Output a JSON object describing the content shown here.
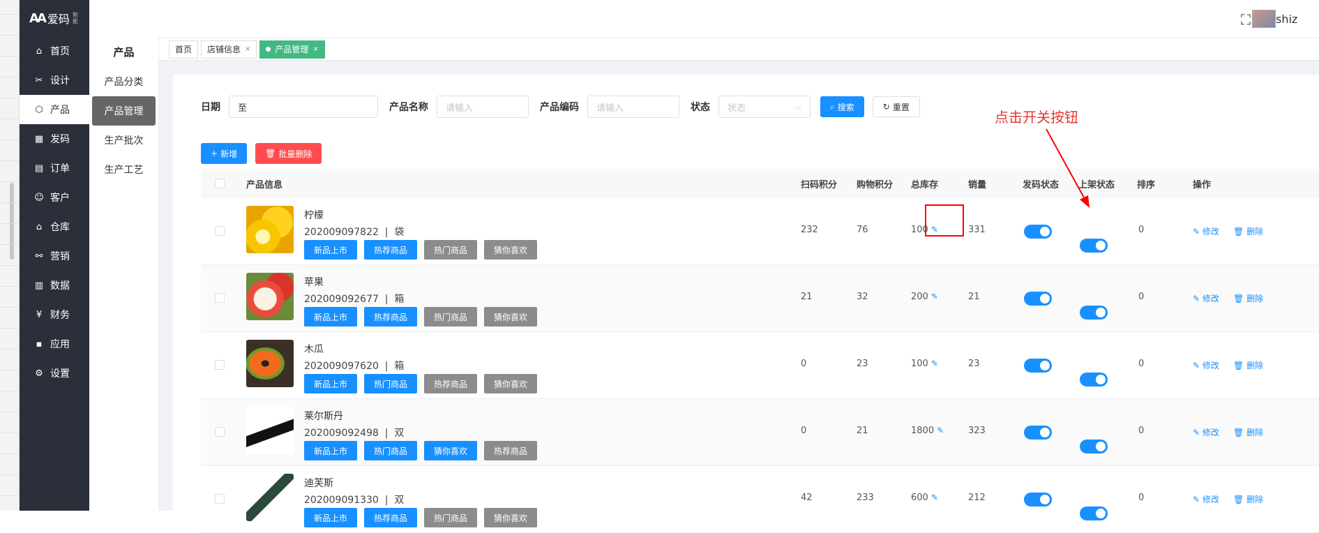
{
  "app": {
    "logo_mark": "AA",
    "logo_text": "爱码",
    "logo_sub": "智能"
  },
  "sidebar": {
    "items": [
      {
        "label": "首页",
        "icon": "home-icon",
        "glyph": "⌂"
      },
      {
        "label": "设计",
        "icon": "tools-icon",
        "glyph": "✂"
      },
      {
        "label": "产品",
        "icon": "cube-icon",
        "glyph": "⬡"
      },
      {
        "label": "发码",
        "icon": "qrcode-icon",
        "glyph": "▦"
      },
      {
        "label": "订单",
        "icon": "order-icon",
        "glyph": "▤"
      },
      {
        "label": "客户",
        "icon": "customer-icon",
        "glyph": "☺"
      },
      {
        "label": "仓库",
        "icon": "warehouse-icon",
        "glyph": "⌂"
      },
      {
        "label": "营销",
        "icon": "share-icon",
        "glyph": "⚯"
      },
      {
        "label": "数据",
        "icon": "chart-icon",
        "glyph": "▥"
      },
      {
        "label": "财务",
        "icon": "yen-icon",
        "glyph": "¥"
      },
      {
        "label": "应用",
        "icon": "grid-icon",
        "glyph": "▪"
      },
      {
        "label": "设置",
        "icon": "gear-icon",
        "glyph": "⚙"
      }
    ]
  },
  "subnav": {
    "title": "产品",
    "items": [
      "产品分类",
      "产品管理",
      "生产批次",
      "生产工艺"
    ]
  },
  "topbar": {
    "username": "shiz"
  },
  "tabs": [
    {
      "label": "首页"
    },
    {
      "label": "店铺信息",
      "x": "×"
    },
    {
      "label": "产品管理",
      "x": "×"
    }
  ],
  "filter": {
    "date_label": "日期",
    "date_sep": "至",
    "name_label": "产品名称",
    "name_placeholder": "请输入",
    "code_label": "产品编码",
    "code_placeholder": "请输入",
    "status_label": "状态",
    "status_placeholder": "状态",
    "search_label": "搜索",
    "reset_label": "重置"
  },
  "actions": {
    "add_label": "新增",
    "batch_delete_label": "批量删除"
  },
  "table": {
    "headers": [
      "产品信息",
      "扫码积分",
      "购物积分",
      "总库存",
      "销量",
      "发码状态",
      "上架状态",
      "排序",
      "操作"
    ],
    "edit_label": "修改",
    "delete_label": "删除",
    "rows": [
      {
        "name": "柠檬",
        "code": "202009097822",
        "unit": "袋",
        "tags": [
          {
            "t": "新品上市",
            "c": "blue"
          },
          {
            "t": "热荐商品",
            "c": "blue"
          },
          {
            "t": "热门商品",
            "c": "gray"
          },
          {
            "t": "猜你喜欢",
            "c": "gray"
          }
        ],
        "scan": "232",
        "shop": "76",
        "stock": "100",
        "sales": "331",
        "sort": "0",
        "img": "lemon"
      },
      {
        "name": "苹果",
        "code": "202009092677",
        "unit": "箱",
        "tags": [
          {
            "t": "新品上市",
            "c": "blue"
          },
          {
            "t": "热荐商品",
            "c": "blue"
          },
          {
            "t": "热门商品",
            "c": "gray"
          },
          {
            "t": "猜你喜欢",
            "c": "gray"
          }
        ],
        "scan": "21",
        "shop": "32",
        "stock": "200",
        "sales": "21",
        "sort": "0",
        "img": "apple"
      },
      {
        "name": "木瓜",
        "code": "202009097620",
        "unit": "箱",
        "tags": [
          {
            "t": "新品上市",
            "c": "blue"
          },
          {
            "t": "热门商品",
            "c": "blue"
          },
          {
            "t": "热荐商品",
            "c": "gray"
          },
          {
            "t": "猜你喜欢",
            "c": "gray"
          }
        ],
        "scan": "0",
        "shop": "23",
        "stock": "100",
        "sales": "23",
        "sort": "0",
        "img": "papaya"
      },
      {
        "name": "莱尔斯丹",
        "code": "202009092498",
        "unit": "双",
        "tags": [
          {
            "t": "新品上市",
            "c": "blue"
          },
          {
            "t": "热门商品",
            "c": "blue"
          },
          {
            "t": "猜你喜欢",
            "c": "blue"
          },
          {
            "t": "热荐商品",
            "c": "gray"
          }
        ],
        "scan": "0",
        "shop": "21",
        "stock": "1800",
        "sales": "323",
        "sort": "0",
        "img": "shoe1"
      },
      {
        "name": "迪芙斯",
        "code": "202009091330",
        "unit": "双",
        "tags": [
          {
            "t": "新品上市",
            "c": "blue"
          },
          {
            "t": "热荐商品",
            "c": "blue"
          },
          {
            "t": "热门商品",
            "c": "gray"
          },
          {
            "t": "猜你喜欢",
            "c": "gray"
          }
        ],
        "scan": "42",
        "shop": "233",
        "stock": "600",
        "sales": "212",
        "sort": "0",
        "img": "shoe2"
      }
    ]
  },
  "annotation": {
    "text": "点击开关按钮"
  }
}
